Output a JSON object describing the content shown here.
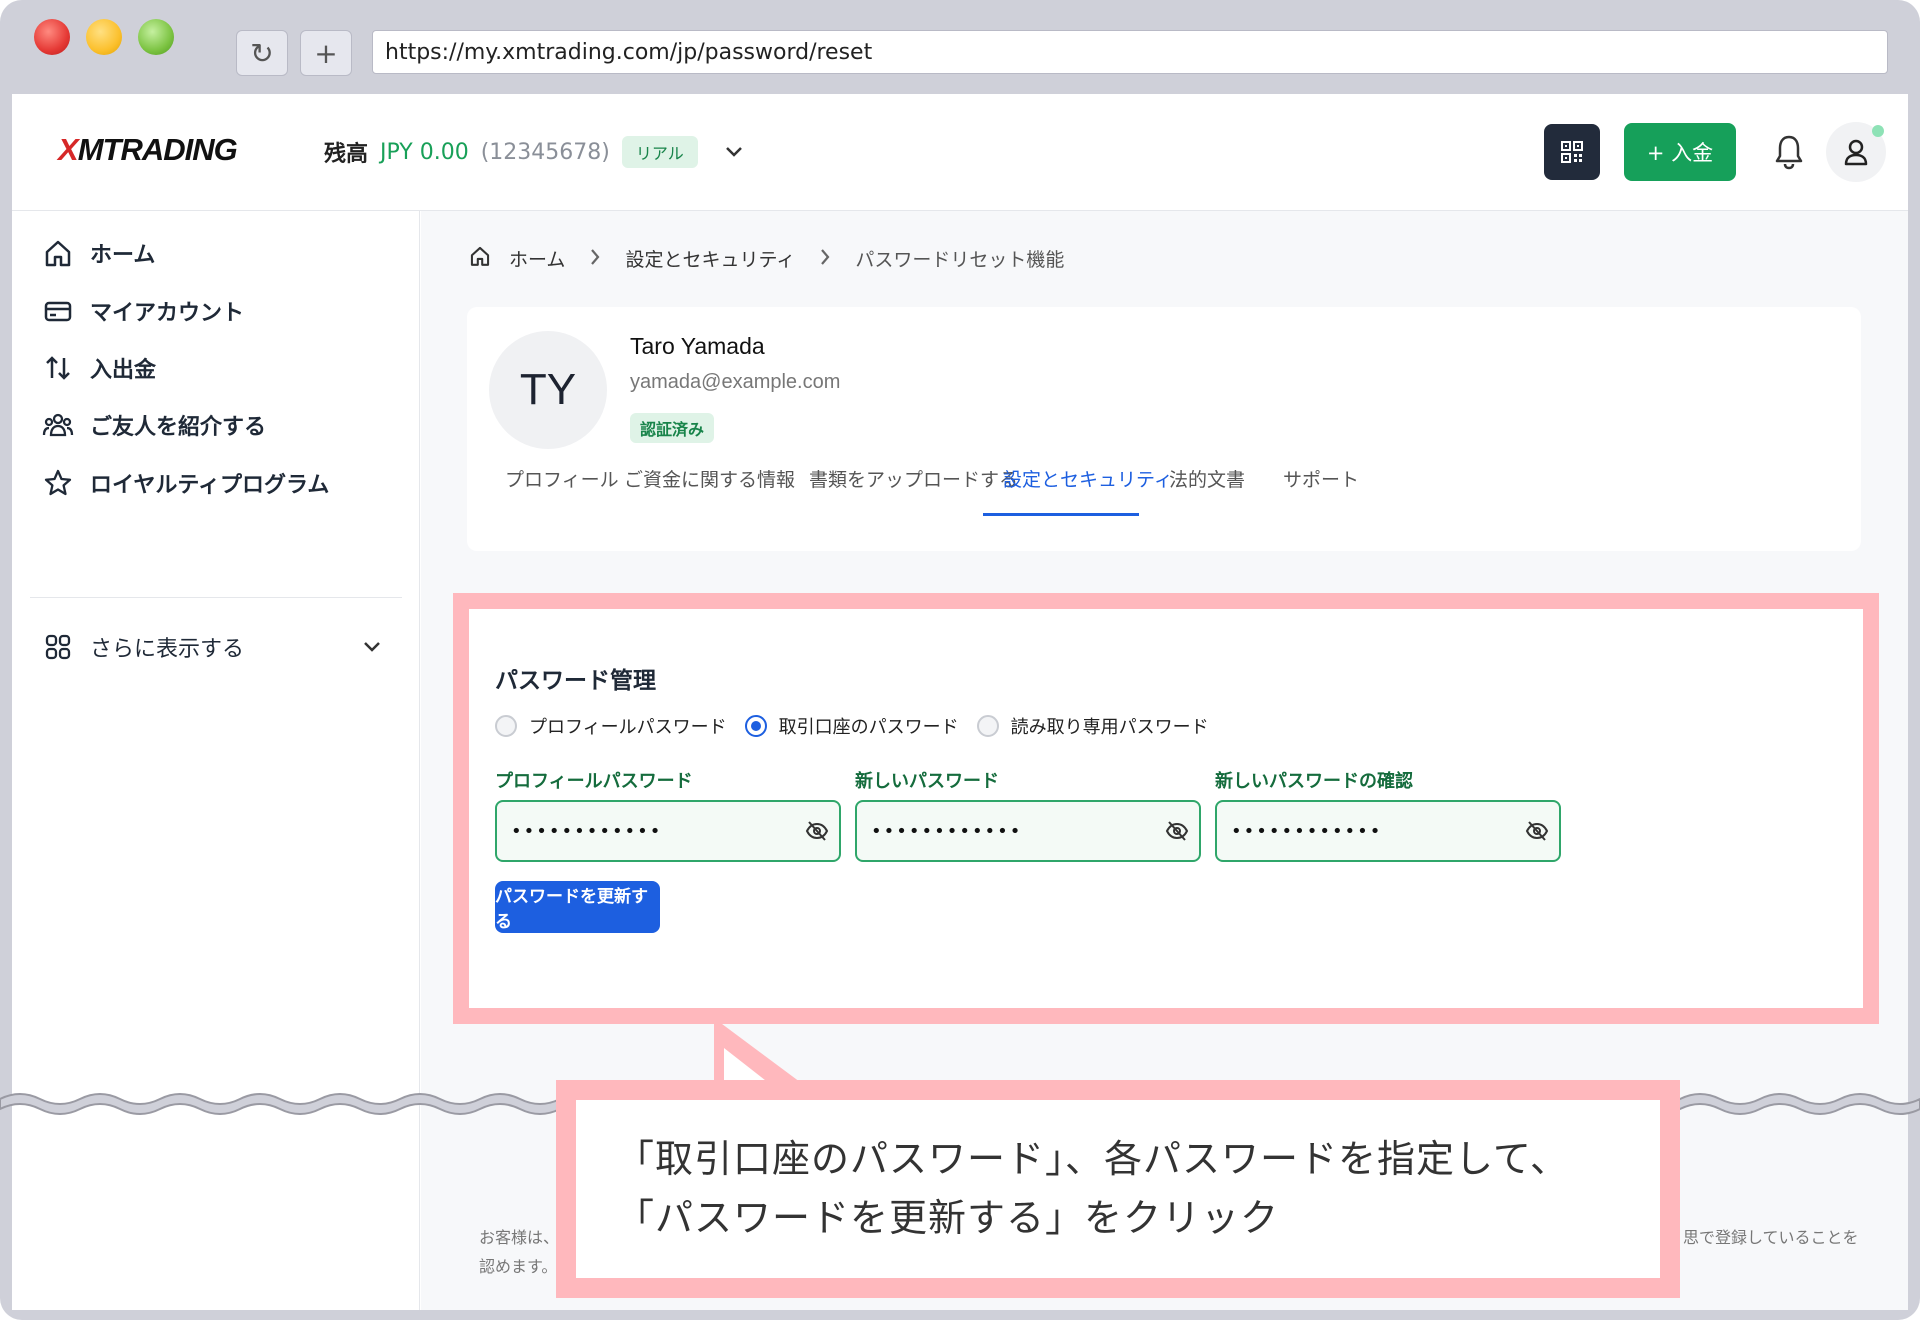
{
  "browser": {
    "url": "https://my.xmtrading.com/jp/password/reset",
    "refresh_icon": "↻",
    "new_tab_icon": "+"
  },
  "header": {
    "logo_mark": "X",
    "logo_text": "MTRADING",
    "balance_label": "残高",
    "balance_amount": "JPY 0.00",
    "account_number": "(12345678)",
    "account_type": "リアル",
    "deposit_label": "+ 入金",
    "icons": [
      "qr-code-icon",
      "bell-icon",
      "user-icon",
      "chevron-down-icon"
    ]
  },
  "sidebar": {
    "items": [
      {
        "label": "ホーム",
        "icon": "home-icon"
      },
      {
        "label": "マイアカウント",
        "icon": "card-icon"
      },
      {
        "label": "入出金",
        "icon": "transfer-arrows-icon"
      },
      {
        "label": "ご友人を紹介する",
        "icon": "users-icon"
      },
      {
        "label": "ロイヤルティプログラム",
        "icon": "star-icon"
      }
    ],
    "more_label": "さらに表示する"
  },
  "breadcrumb": {
    "items": [
      "ホーム",
      "設定とセキュリティ",
      "パスワードリセット機能"
    ]
  },
  "profile": {
    "initials": "TY",
    "name": "Taro Yamada",
    "email": "yamada@example.com",
    "status": "認証済み"
  },
  "tabs": [
    {
      "label": "プロフィール",
      "active": false
    },
    {
      "label": "ご資金に関する情報",
      "active": false
    },
    {
      "label": "書類をアップロードする",
      "active": false
    },
    {
      "label": "設定とセキュリティ",
      "active": true
    },
    {
      "label": "法的文書",
      "active": false
    },
    {
      "label": "サポート",
      "active": false
    }
  ],
  "password": {
    "title": "パスワード管理",
    "options": [
      {
        "label": "プロフィールパスワード",
        "selected": false
      },
      {
        "label": "取引口座のパスワード",
        "selected": true
      },
      {
        "label": "読み取り専用パスワード",
        "selected": false
      }
    ],
    "fields": [
      {
        "label": "プロフィールパスワード",
        "value": "••••••••••••"
      },
      {
        "label": "新しいパスワード",
        "value": "••••••••••••"
      },
      {
        "label": "新しいパスワードの確認",
        "value": "••••••••••••"
      }
    ],
    "submit_label": "パスワードを更新する"
  },
  "footer": {
    "left_line1": "お客様は、",
    "left_line2": "認めます。",
    "right_line1": "思で登録していることを"
  },
  "callout": {
    "line1": "「取引口座のパスワード」、各パスワードを指定して、",
    "line2": "「パスワードを更新する」をクリック"
  },
  "colors": {
    "accent_green": "#16a05a",
    "accent_blue": "#1d5fe0",
    "highlight_pink": "#ffb8bd"
  }
}
